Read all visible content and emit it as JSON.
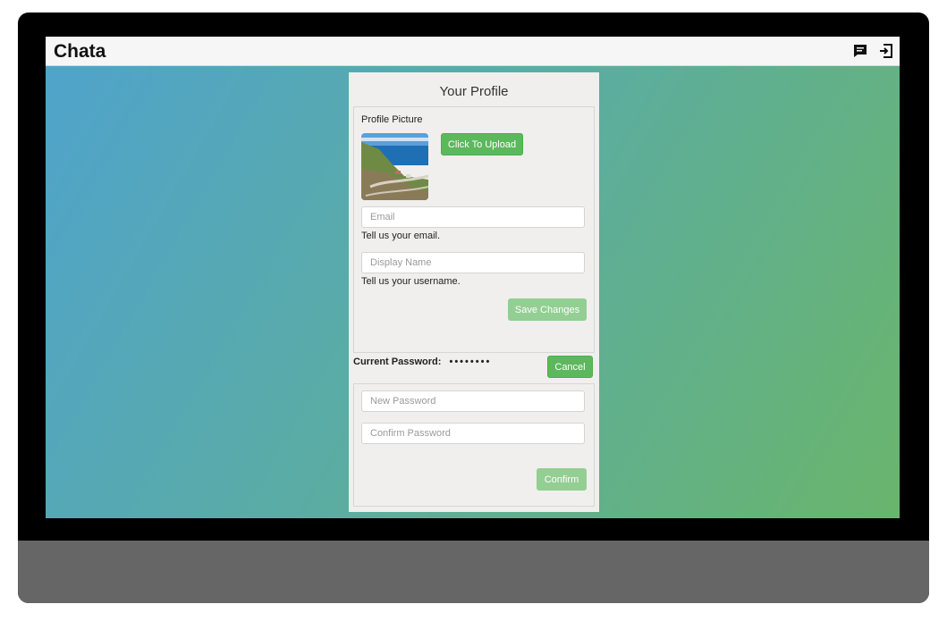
{
  "app": {
    "brand": "Chata",
    "icons": {
      "chat": "chat-icon",
      "logout": "logout-icon"
    }
  },
  "colors": {
    "accent_green": "#5cb85c",
    "disabled_green": "#93ce93",
    "gradient_start": "#4fa3cc",
    "gradient_end": "#6ab56c",
    "card_bg": "#f0efed"
  },
  "profile": {
    "title": "Your Profile",
    "picture_label": "Profile Picture",
    "upload_label": "Click To Upload",
    "email": {
      "value": "",
      "placeholder": "Email",
      "help": "Tell us your email."
    },
    "display_name": {
      "value": "",
      "placeholder": "Display Name",
      "help": "Tell us your username."
    },
    "save_label": "Save Changes"
  },
  "password": {
    "current_label": "Current Password:",
    "current_value": "••••••••",
    "cancel_label": "Cancel",
    "new_placeholder": "New Password",
    "confirm_placeholder": "Confirm Password",
    "confirm_label": "Confirm"
  }
}
